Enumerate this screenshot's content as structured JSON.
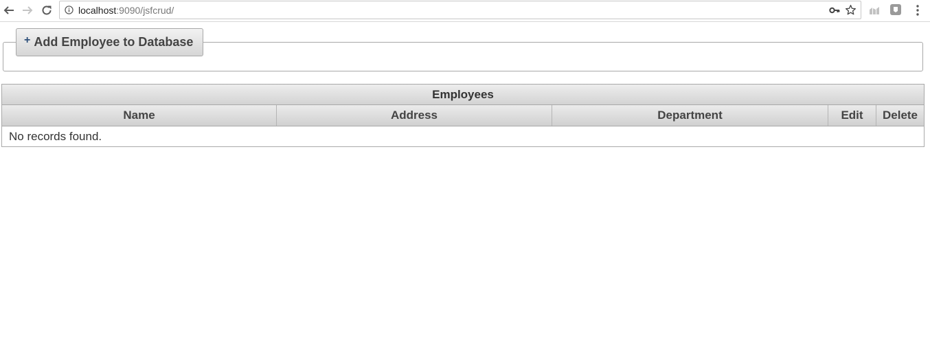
{
  "browser": {
    "url_host": "localhost",
    "url_rest": ":9090/jsfcrud/",
    "icons": {
      "back": "arrow-left-icon",
      "forward": "arrow-right-icon",
      "reload": "reload-icon",
      "info": "info-icon",
      "key": "key-icon",
      "star": "star-icon",
      "extension1": "chart-extension-icon",
      "extension2": "extension-icon",
      "menu": "kebab-menu-icon"
    }
  },
  "form": {
    "add_button_icon": "+",
    "add_button_label": "Add Employee to Database"
  },
  "table": {
    "caption": "Employees",
    "columns": [
      "Name",
      "Address",
      "Department",
      "Edit",
      "Delete"
    ],
    "rows": [],
    "empty_message": "No records found."
  },
  "colors": {
    "accent_plus": "#2d4f7a",
    "header_gradient_top": "#ebebeb",
    "header_gradient_bottom": "#d0d0d0",
    "border": "#a8a8a8"
  }
}
